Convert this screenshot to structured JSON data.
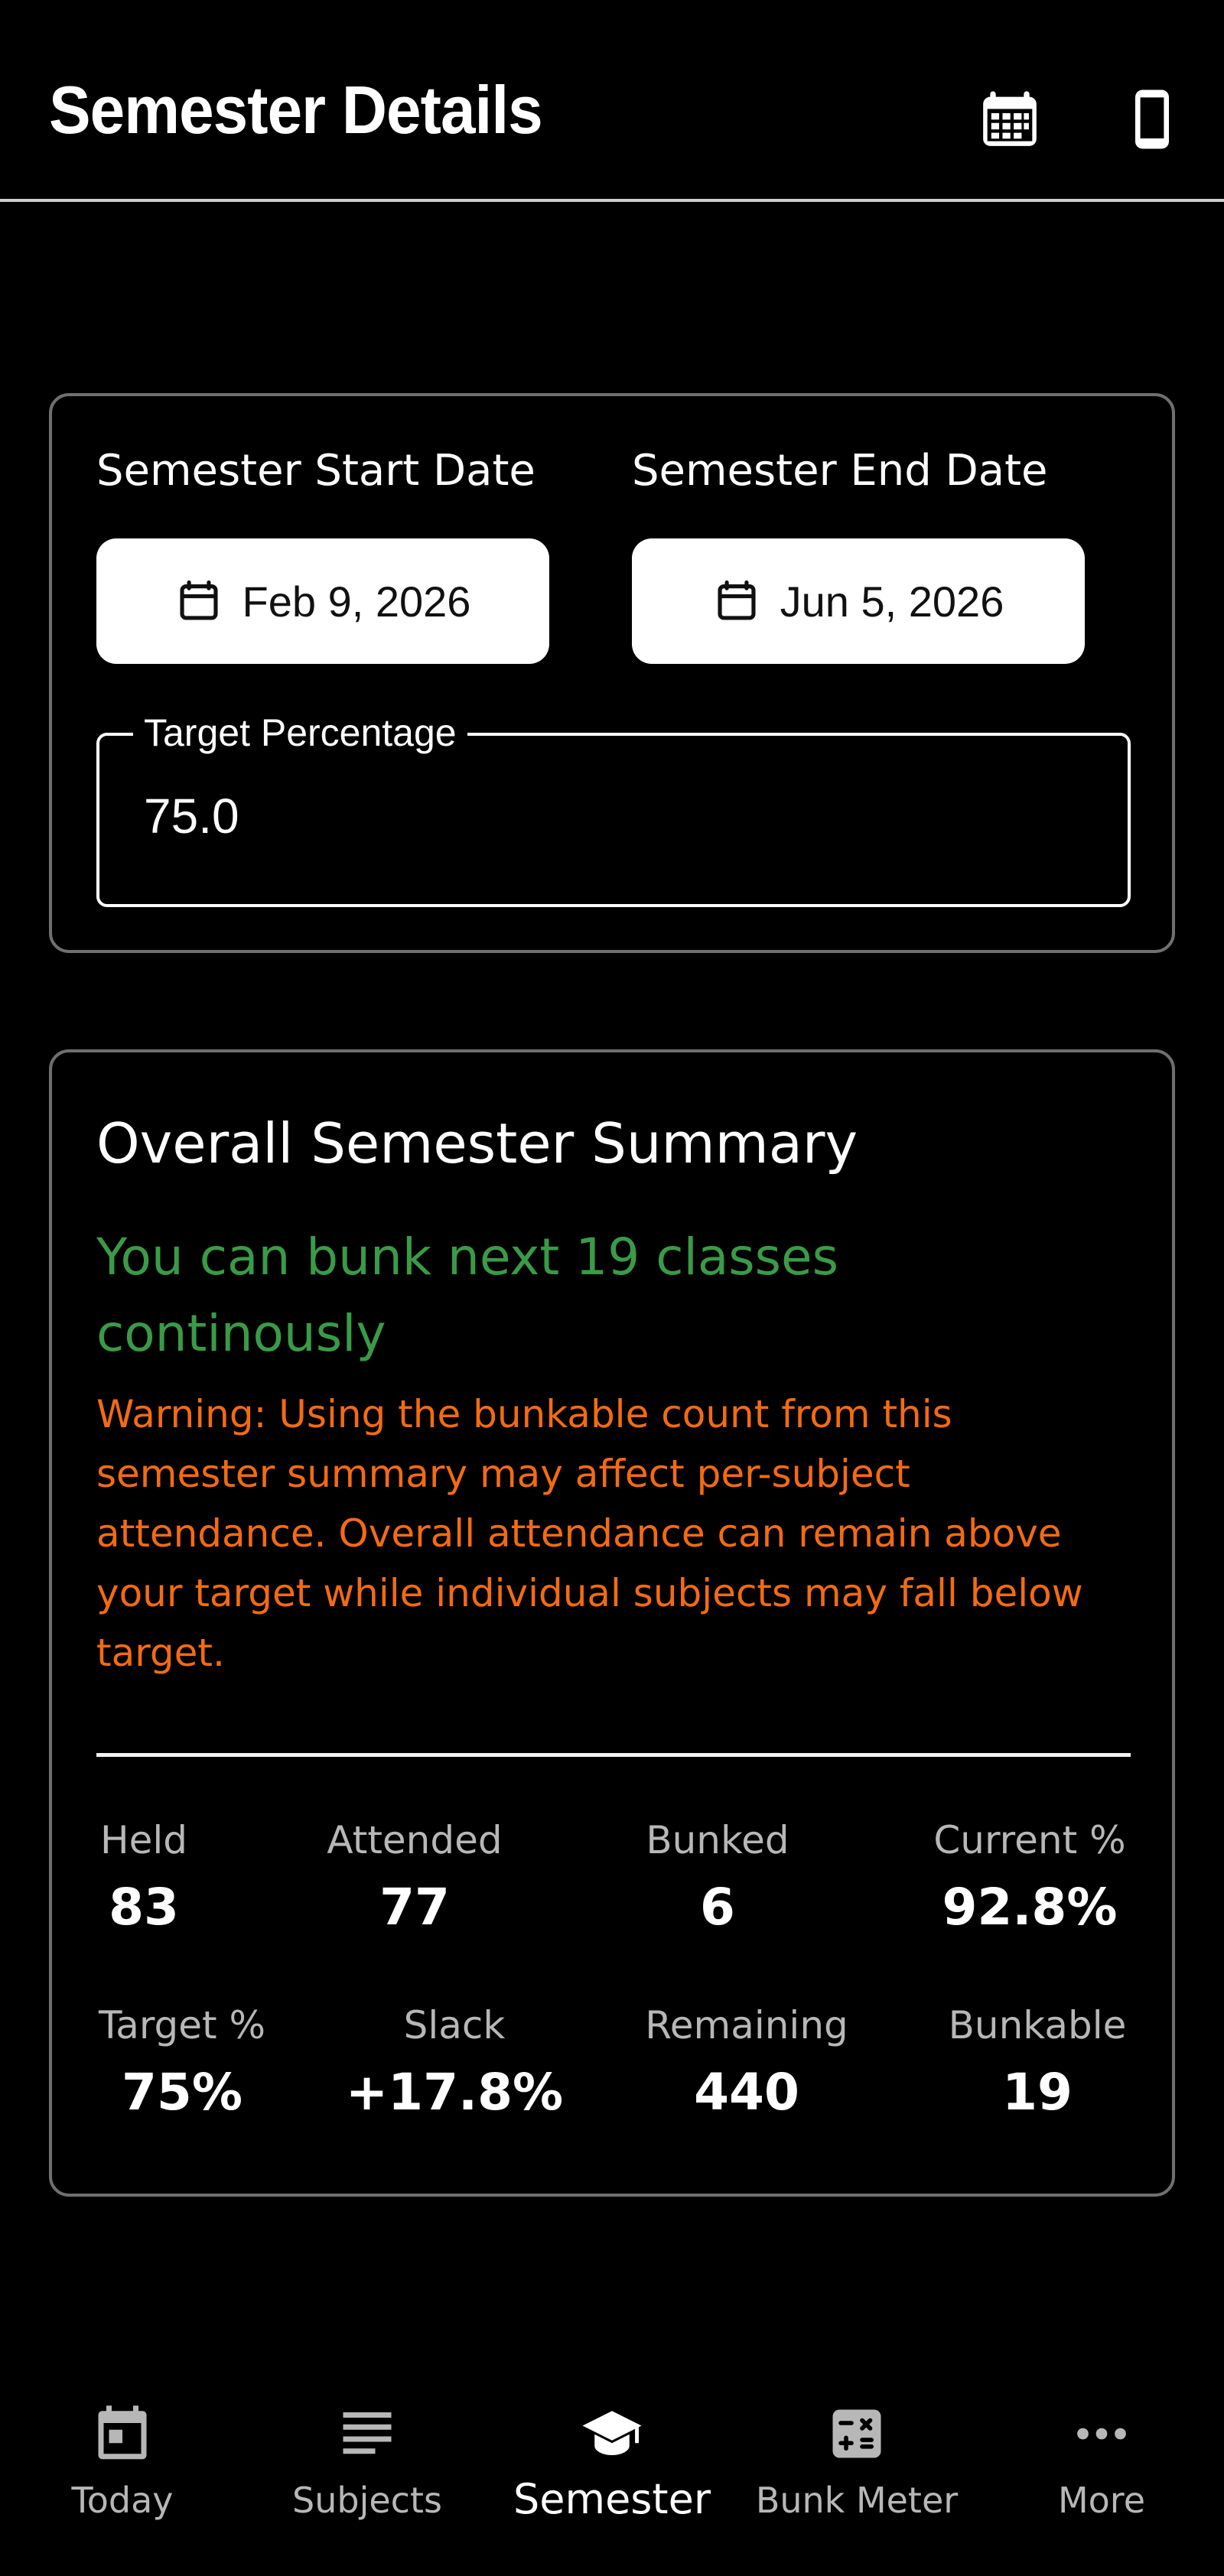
{
  "header": {
    "title": "Semester Details",
    "calendar_icon": "calendar-grid-icon",
    "device_icon": "smartphone-icon"
  },
  "settings": {
    "start_label": "Semester Start Date",
    "end_label": "Semester End Date",
    "start_date": "Feb 9, 2026",
    "end_date": "Jun 5, 2026",
    "target_label": "Target Percentage",
    "target_value": "75.0"
  },
  "summary": {
    "title": "Overall Semester Summary",
    "bunk_message": "You can bunk next 19 classes continously",
    "warning": "Warning: Using the bunkable count from this semester summary may affect per-subject attendance. Overall attendance can remain above your target while individual subjects may fall below target.",
    "stats": [
      {
        "label": "Held",
        "value": "83"
      },
      {
        "label": "Attended",
        "value": "77"
      },
      {
        "label": "Bunked",
        "value": "6"
      },
      {
        "label": "Current %",
        "value": "92.8%"
      },
      {
        "label": "Target %",
        "value": "75%"
      },
      {
        "label": "Slack",
        "value": "+17.8%"
      },
      {
        "label": "Remaining",
        "value": "440"
      },
      {
        "label": "Bunkable",
        "value": "19"
      }
    ]
  },
  "nav": {
    "items": [
      {
        "label": "Today",
        "icon": "calendar-today-icon",
        "active": false
      },
      {
        "label": "Subjects",
        "icon": "list-lines-icon",
        "active": false
      },
      {
        "label": "Semester",
        "icon": "graduation-cap-icon",
        "active": true
      },
      {
        "label": "Bunk Meter",
        "icon": "calculator-icon",
        "active": false
      },
      {
        "label": "More",
        "icon": "more-dots-icon",
        "active": false
      }
    ]
  },
  "colors": {
    "background": "#000000",
    "success": "#3a9b46",
    "warning": "#f26b12",
    "border": "#6f6f6f",
    "muted_text": "#b7b7b7"
  }
}
